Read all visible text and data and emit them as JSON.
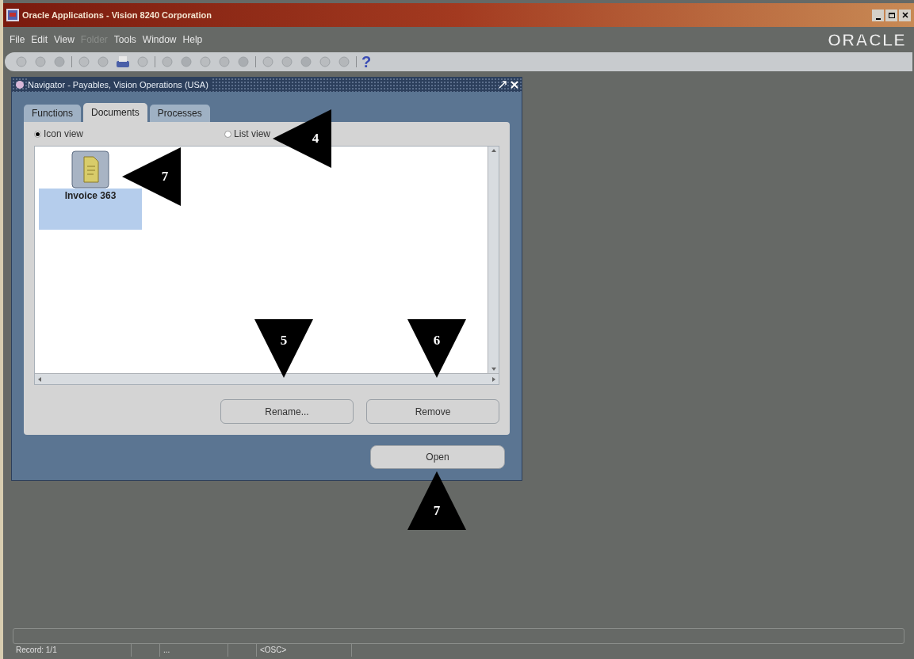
{
  "window": {
    "title": "Oracle Applications - Vision 8240 Corporation",
    "brand": "ORACLE"
  },
  "menu": [
    {
      "label": "File",
      "disabled": false
    },
    {
      "label": "Edit",
      "disabled": false
    },
    {
      "label": "View",
      "disabled": false
    },
    {
      "label": "Folder",
      "disabled": true
    },
    {
      "label": "Tools",
      "disabled": false
    },
    {
      "label": "Window",
      "disabled": false
    },
    {
      "label": "Help",
      "disabled": false
    }
  ],
  "toolbar": {
    "help": "?"
  },
  "navigator": {
    "title": "Navigator - Payables, Vision Operations (USA)",
    "tabs": [
      {
        "label": "Functions",
        "selected": false
      },
      {
        "label": "Documents",
        "selected": true
      },
      {
        "label": "Processes",
        "selected": false
      }
    ],
    "views": [
      {
        "label": "Icon view",
        "selected": true
      },
      {
        "label": "List view",
        "selected": false
      }
    ],
    "documents": [
      {
        "label": "Invoice 363",
        "selected": true
      }
    ],
    "buttons": [
      "Rename...",
      "Remove"
    ],
    "open_button": "Open"
  },
  "status_bar": [
    "Record: 1/1",
    "...",
    "<OSC>"
  ],
  "callouts": [
    {
      "label": "4",
      "kind": "left"
    },
    {
      "label": "7",
      "kind": "left"
    },
    {
      "label": "5",
      "kind": "down"
    },
    {
      "label": "6",
      "kind": "down"
    },
    {
      "label": "7",
      "kind": "up"
    }
  ]
}
